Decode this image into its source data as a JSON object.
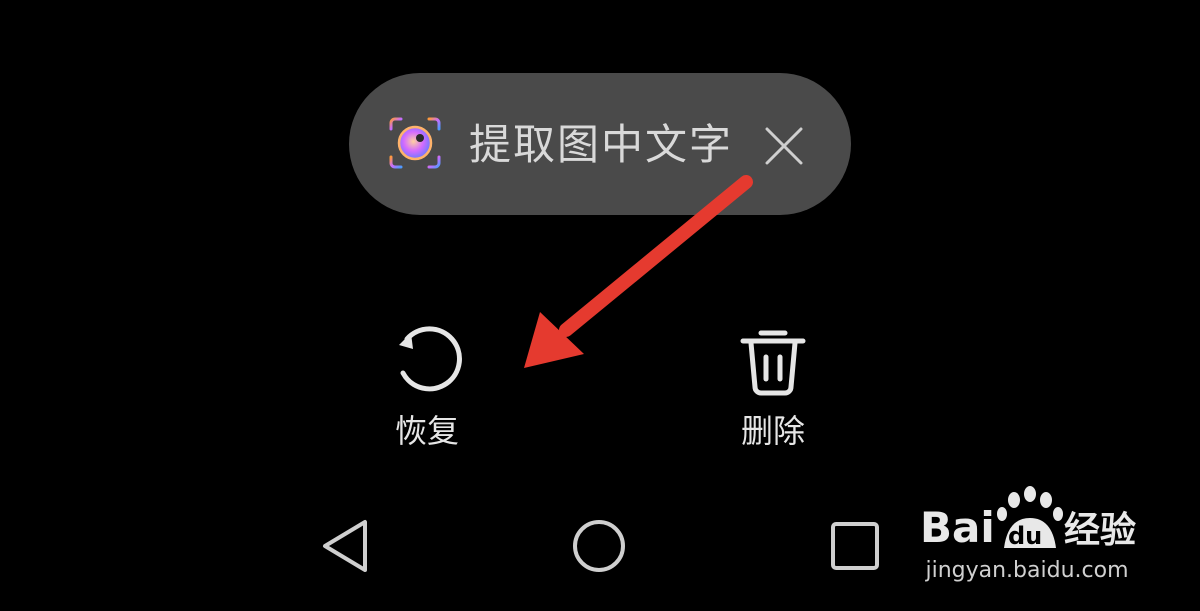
{
  "extract_pill": {
    "icon": "scan-eye-icon",
    "label": "提取图中文字",
    "close_icon": "close-icon"
  },
  "actions": {
    "restore": {
      "icon": "restore-icon",
      "label": "恢复"
    },
    "delete": {
      "icon": "trash-icon",
      "label": "删除"
    }
  },
  "navbar": {
    "back_icon": "back-triangle-icon",
    "home_icon": "home-circle-icon",
    "recent_icon": "recents-square-icon"
  },
  "annotation": {
    "icon": "red-arrow-icon",
    "color": "#e53a2f"
  },
  "watermark": {
    "brand": "Bai",
    "brand_du": "du",
    "product": "经验",
    "url": "jingyan.baidu.com"
  },
  "colors": {
    "background": "#000000",
    "pill": "#4a4a4a",
    "text": "#e6e6e6"
  }
}
